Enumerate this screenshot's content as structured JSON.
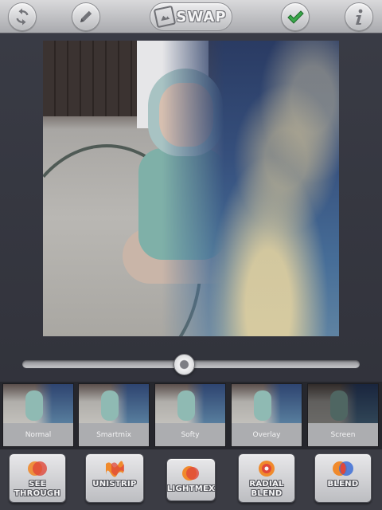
{
  "toolbar": {
    "brand_text": "SWAP",
    "icons": [
      "refresh-icon",
      "pencil-icon",
      "checkmark-icon",
      "info-icon"
    ],
    "check_color": "#3aa84a"
  },
  "slider": {
    "value": 0.48
  },
  "filters": [
    {
      "label": "Normal"
    },
    {
      "label": "Smartmix"
    },
    {
      "label": "Softy"
    },
    {
      "label": "Overlay"
    },
    {
      "label": "Screen"
    }
  ],
  "modes": [
    {
      "label": "SEE\nTHROUGH"
    },
    {
      "label": "UNISTRIP"
    },
    {
      "label": "LIGHTMEX"
    },
    {
      "label": "RADIAL\nBLEND"
    },
    {
      "label": "BLEND"
    }
  ],
  "colors": {
    "accent_orange": "#f08a2c",
    "accent_red": "#e0473a",
    "accent_blue": "#3d6fd6"
  }
}
